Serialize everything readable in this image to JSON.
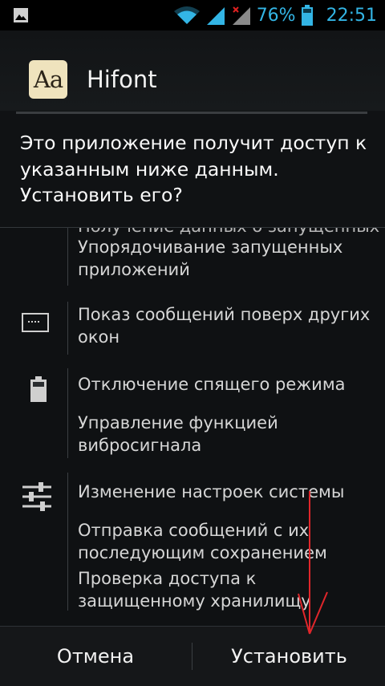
{
  "status_bar": {
    "battery_percent": "76%",
    "time": "22:51",
    "icons": [
      "image-icon",
      "wifi-icon",
      "signal-icon",
      "signal-no-sim-icon",
      "battery-icon"
    ]
  },
  "app": {
    "icon_text": "Aa",
    "name": "Hifont"
  },
  "prompt": "Это приложение получит доступ к указанным ниже данным. Установить его?",
  "permissions": {
    "cut_off_item": "Получение данных о запущенных",
    "groups": [
      {
        "icon": "apps-icon",
        "items": [
          "Упорядочивание запущенных приложений"
        ]
      },
      {
        "icon": "window-overlay-icon",
        "items": [
          "Показ сообщений поверх других окон"
        ]
      },
      {
        "icon": "battery-icon",
        "items": [
          "Отключение спящего режима",
          "Управление функцией вибросигнала"
        ]
      },
      {
        "icon": "settings-sliders-icon",
        "items": [
          "Изменение настроек системы",
          "Отправка сообщений с их последующим сохранением",
          "Проверка доступа к защищенному хранилищу"
        ]
      }
    ]
  },
  "buttons": {
    "cancel": "Отмена",
    "install": "Установить"
  },
  "colors": {
    "accent": "#33b5e5",
    "annotation_arrow": "#e0262b"
  }
}
